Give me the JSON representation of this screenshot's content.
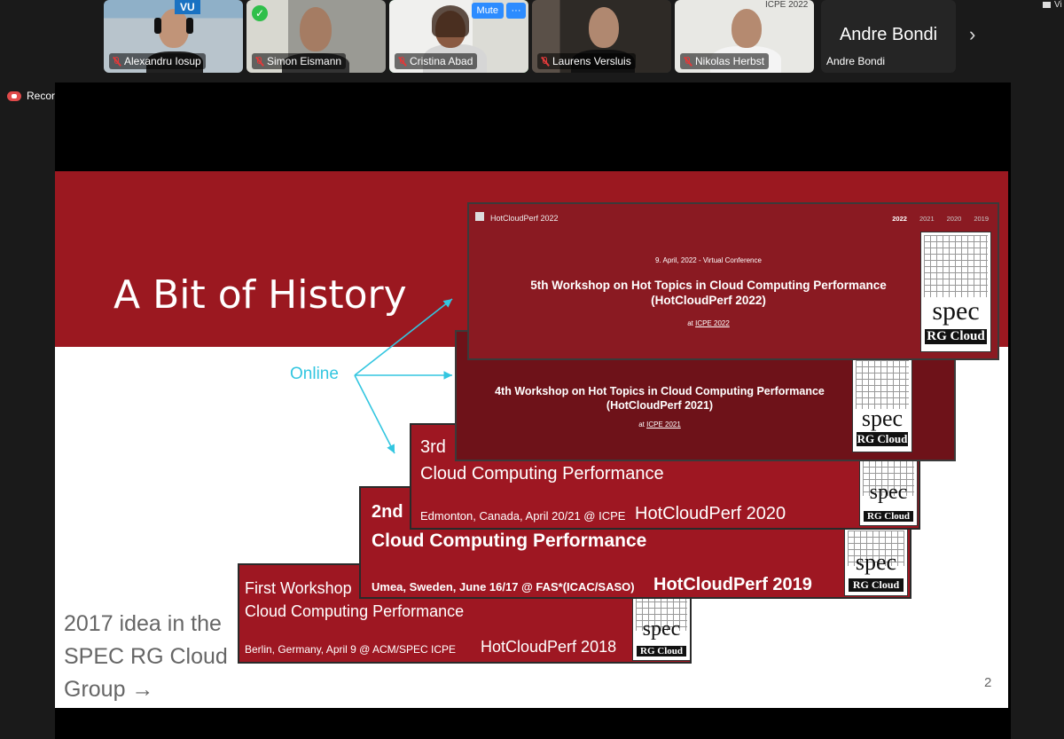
{
  "participants": [
    {
      "name": "Alexandru Iosup",
      "badge": "VU"
    },
    {
      "name": "Simon Eismann"
    },
    {
      "name": "Cristina Abad",
      "mute_label": "Mute",
      "more_label": "···"
    },
    {
      "name": "Laurens Versluis"
    },
    {
      "name": "Nikolas Herbst",
      "bg_text": "ICPE 2022"
    },
    {
      "name": "Andre Bondi",
      "display_title": "Andre Bondi"
    }
  ],
  "recording": {
    "label": "Recording..."
  },
  "topright": {
    "label": "Vi"
  },
  "slide": {
    "title": "A Bit of History",
    "online_label": "Online",
    "idea_lines": [
      "2017 idea in the",
      "SPEC RG Cloud",
      "Group →"
    ],
    "page_number": "2"
  },
  "web2022": {
    "site": "HotCloudPerf 2022",
    "years": [
      "2022",
      "2021",
      "2020",
      "2019"
    ],
    "date": "9. April, 2022 - Virtual Conference",
    "line1": "5th Workshop on Hot Topics in Cloud Computing Performance",
    "line2": "(HotCloudPerf 2022)",
    "at_prefix": "at",
    "at_link": "ICPE 2022"
  },
  "web2021": {
    "line1": "4th Workshop on Hot Topics in Cloud Computing Performance",
    "line2": "(HotCloudPerf 2021)",
    "at_prefix": "at",
    "at_link": "ICPE 2021"
  },
  "card2020": {
    "line1": "3rd",
    "line2": "Cloud Computing Performance",
    "place": "Edmonton, Canada, April 20/21 @ ICPE",
    "brand": "HotCloudPerf 2020"
  },
  "card2019": {
    "line1": "2nd",
    "line2": "Cloud Computing Performance",
    "place": "Umea, Sweden, June 16/17 @ FAS*(ICAC/SASO)",
    "brand": "HotCloudPerf 2019"
  },
  "card2018": {
    "line1": "First Workshop",
    "line2": "Cloud Computing Performance",
    "place": "Berlin, Germany, April 9 @ ACM/SPEC ICPE",
    "brand": "HotCloudPerf 2018"
  },
  "spec_logo": {
    "word": "spec",
    "sub": "RG Cloud"
  },
  "colors": {
    "slide_red": "#9b1820",
    "online_cyan": "#33c6e0",
    "speaking_green": "#27c24c",
    "zoom_blue": "#2d8cff"
  }
}
